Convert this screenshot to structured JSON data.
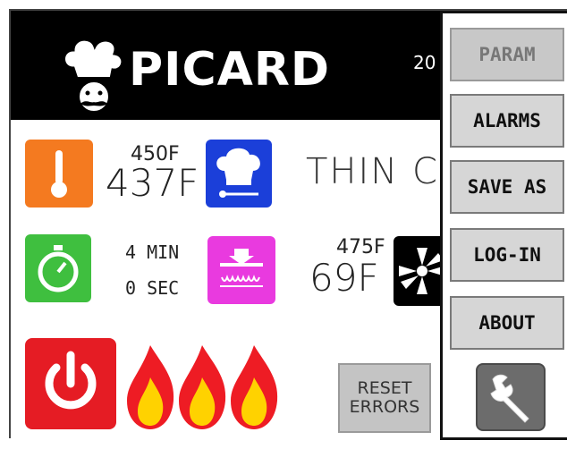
{
  "header": {
    "brand": "PICARD",
    "clipped_text": "20"
  },
  "temperature": {
    "setpoint": "450F",
    "current": "437F"
  },
  "recipe": {
    "name_visible": "THIN C"
  },
  "timer": {
    "minutes": "4 MIN",
    "seconds": "0 SEC"
  },
  "heat": {
    "setpoint": "475F",
    "current": "69F"
  },
  "reset_button": {
    "line1": "RESET",
    "line2": "ERRORS"
  },
  "menu": {
    "items": [
      {
        "label": "PARAM",
        "enabled": false
      },
      {
        "label": "ALARMS",
        "enabled": true
      },
      {
        "label": "SAVE AS",
        "enabled": true
      },
      {
        "label": "LOG-IN",
        "enabled": true
      },
      {
        "label": "ABOUT",
        "enabled": true
      }
    ]
  },
  "colors": {
    "thermo": "#f47a20",
    "chef_tile": "#1b3fd9",
    "timer_tile": "#3fbf3f",
    "heater_tile": "#e93adf",
    "power": "#e51c24",
    "flame_outer": "#ee1c24",
    "flame_inner": "#ffd200"
  }
}
